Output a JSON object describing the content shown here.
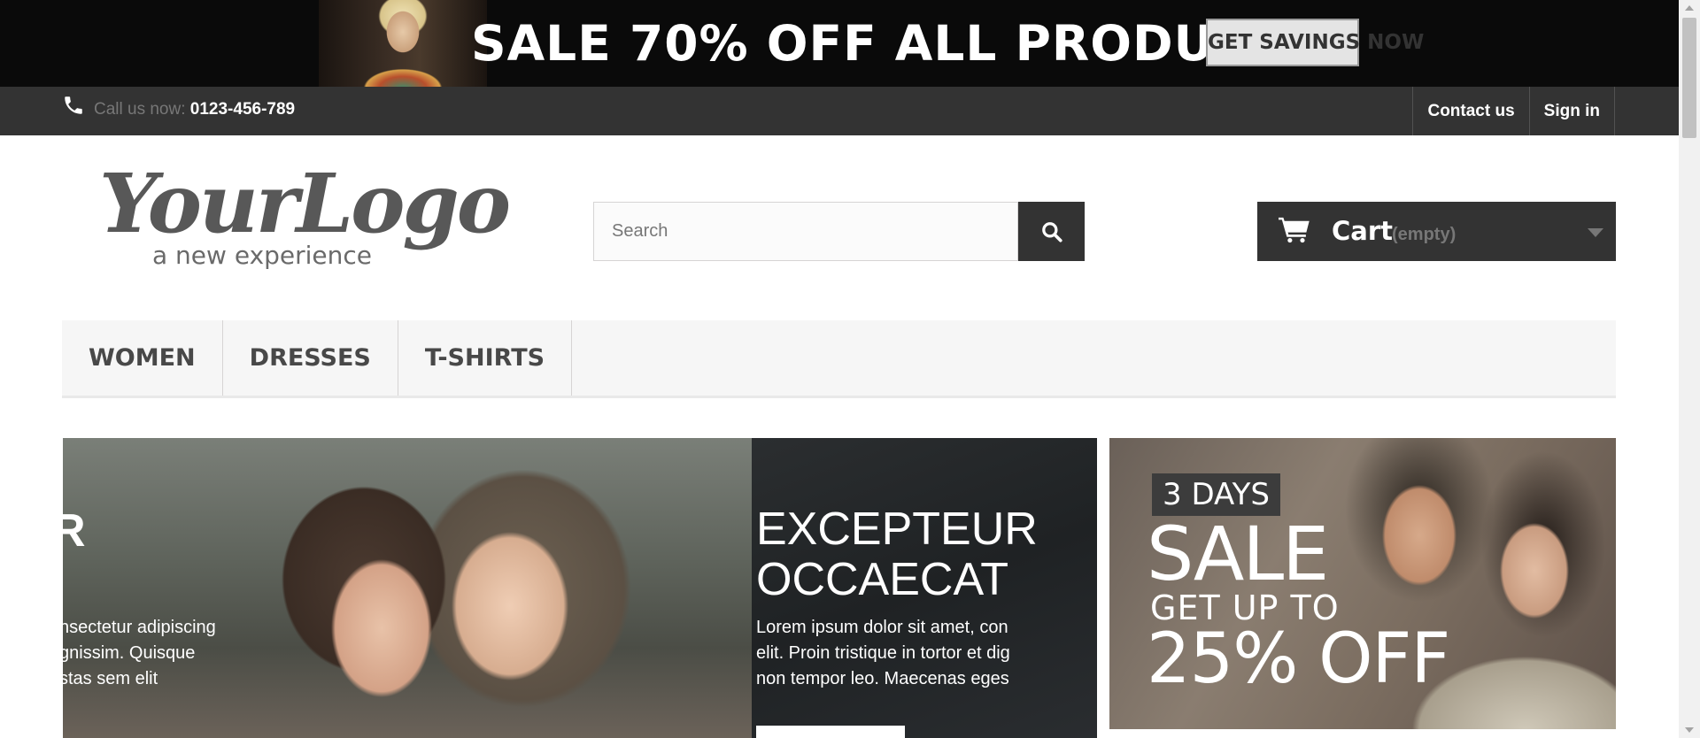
{
  "promo_banner": {
    "text": "SALE 70% OFF ALL PRODUCTS",
    "button_label": "GET SAVINGS NOW"
  },
  "top_nav": {
    "call_label": "Call us now:",
    "phone_number": "0123-456-789",
    "links": [
      "Contact us",
      "Sign in"
    ],
    "icon": "phone-icon"
  },
  "header": {
    "logo_main": "YourLogo",
    "logo_tagline": "a new experience",
    "search_placeholder": "Search",
    "search_icon": "search-icon",
    "cart_label": "Cart",
    "cart_status": "(empty)",
    "cart_icon": "shopping-cart-icon"
  },
  "menu": {
    "items": [
      "WOMEN",
      "DRESSES",
      "T-SHIRTS"
    ]
  },
  "slider": {
    "prev_fragment": "R",
    "prev_text_lines": [
      "nsectetur adipiscing",
      "gnissim. Quisque",
      "stas sem elit"
    ],
    "title_lines": [
      "EXCEPTEUR",
      "OCCAECAT"
    ],
    "text_lines": [
      "Lorem ipsum dolor sit amet, con",
      "elit. Proin tristique in tortor et dig",
      "non tempor leo. Maecenas eges"
    ]
  },
  "side_promo": {
    "days": "3 DAYS",
    "sale": "SALE",
    "subtitle": "GET UP TO",
    "discount": "25% OFF"
  },
  "colors": {
    "dark_bar": "#333333",
    "menu_bg": "#f6f6f6",
    "accent_text": "#ffffff"
  }
}
